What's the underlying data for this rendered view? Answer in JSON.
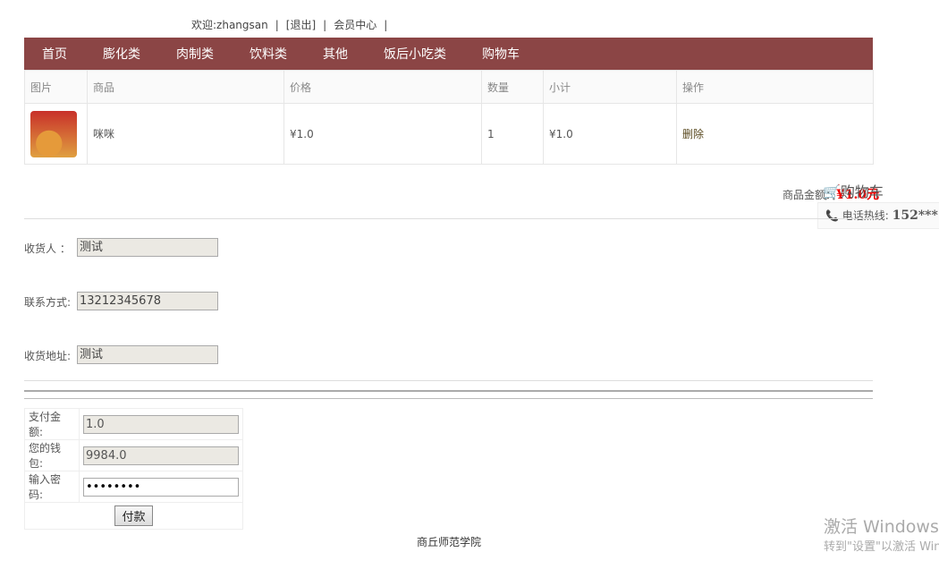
{
  "topbar": {
    "welcome": "欢迎:zhangsan",
    "logout": "[退出]",
    "member": "会员中心",
    "sep": "|"
  },
  "nav": [
    "首页",
    "膨化类",
    "肉制类",
    "饮料类",
    "其他",
    "饭后小吃类",
    "购物车"
  ],
  "cart": {
    "headers": [
      "图片",
      "商品",
      "价格",
      "数量",
      "小计",
      "操作"
    ],
    "rows": [
      {
        "name": "咪咪",
        "price": "¥1.0",
        "qty": "1",
        "subtotal": "¥1.0",
        "action": "删除"
      }
    ]
  },
  "total": {
    "label": "商品金额：",
    "value": "¥1.0元"
  },
  "float": {
    "cart": "购物车",
    "hotline": "电话热线: ",
    "phone": "152***"
  },
  "form": {
    "receiver_label": "收货人  ：",
    "receiver": "测试",
    "contact_label": "联系方式:",
    "contact": "13212345678",
    "address_label": "收货地址:",
    "address": "测试"
  },
  "pay": {
    "amount_label": "支付金额:",
    "amount": "1.0",
    "wallet_label": "您的钱包:",
    "wallet": "9984.0",
    "pwd_label": "输入密码:",
    "pwd": "••••••••",
    "button": "付款"
  },
  "footer": "商丘师范学院",
  "watermark": {
    "line1": "激活 Windows",
    "line2": "转到\"设置\"以激活 Windows。"
  }
}
